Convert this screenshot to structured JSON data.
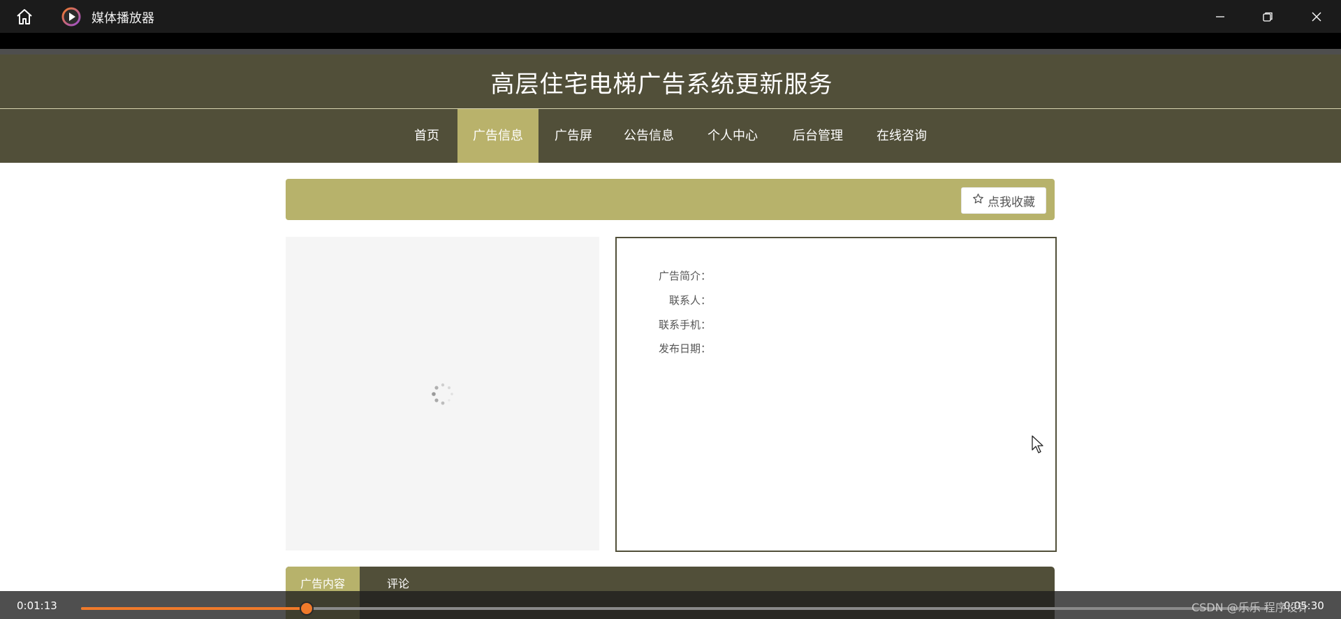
{
  "player": {
    "app_title": "媒体播放器",
    "current_time": "0:01:13",
    "total_time": "0:05:30",
    "progress": 0.19,
    "watermark": "CSDN @乐乐 程序设计",
    "accent_color": "#f07a2a"
  },
  "site": {
    "title": "高层住宅电梯广告系统更新服务",
    "theme_color": "#514f39",
    "accent_color": "#b7b26b"
  },
  "nav": {
    "items": [
      {
        "label": "首页"
      },
      {
        "label": "广告信息"
      },
      {
        "label": "广告屏"
      },
      {
        "label": "公告信息"
      },
      {
        "label": "个人中心"
      },
      {
        "label": "后台管理"
      },
      {
        "label": "在线咨询"
      }
    ],
    "active": "广告信息"
  },
  "collect": {
    "label": "点我收藏",
    "icon": "star-outline-icon"
  },
  "info": {
    "fields": [
      {
        "label": "广告简介："
      },
      {
        "label": "联系人："
      },
      {
        "label": "联系手机："
      },
      {
        "label": "发布日期："
      }
    ]
  },
  "tabs": {
    "items": [
      {
        "label": "广告内容"
      },
      {
        "label": "评论"
      }
    ],
    "active": "广告内容"
  }
}
